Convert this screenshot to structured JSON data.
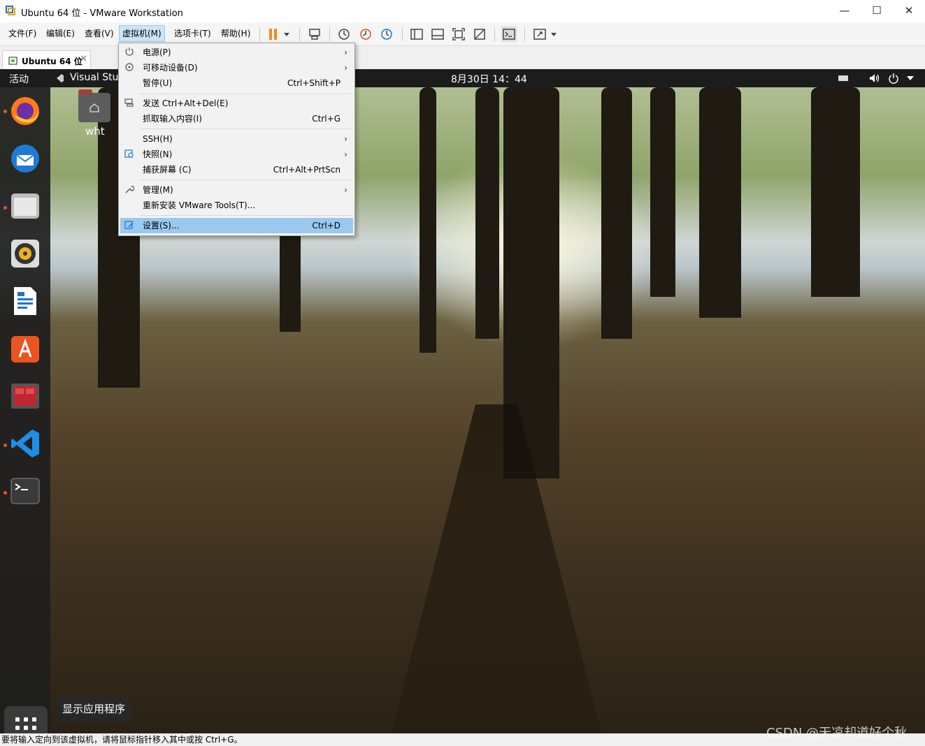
{
  "window": {
    "title": "Ubuntu 64 位 - VMware Workstation",
    "minimize": "—",
    "maximize": "☐",
    "close": "✕"
  },
  "menubar": {
    "items": [
      "文件(F)",
      "编辑(E)",
      "查看(V)",
      "虚拟机(M)",
      "选项卡(T)",
      "帮助(H)"
    ],
    "active_index": 3
  },
  "tab": {
    "label": "Ubuntu 64 位",
    "close": "✕"
  },
  "vm_topbar": {
    "activities": "活动",
    "app": "Visual Stud",
    "clock": "8月30日  14：44"
  },
  "desktop": {
    "home_label": "wht",
    "tooltip": "显示应用程序"
  },
  "dock": {
    "icons": [
      "firefox-icon",
      "thunderbird-icon",
      "files-icon",
      "rhythmbox-icon",
      "writer-icon",
      "software-icon",
      "remmina-icon",
      "vscode-icon",
      "terminal-icon"
    ]
  },
  "dropdown": {
    "items": [
      {
        "label": "电源(P)",
        "shortcut": "",
        "submenu": true
      },
      {
        "label": "可移动设备(D)",
        "shortcut": "",
        "submenu": true
      },
      {
        "label": "暂停(U)",
        "shortcut": "Ctrl+Shift+P",
        "submenu": false
      },
      {
        "label": "发送 Ctrl+Alt+Del(E)",
        "shortcut": "",
        "submenu": false
      },
      {
        "label": "抓取输入内容(I)",
        "shortcut": "Ctrl+G",
        "submenu": false
      },
      {
        "label": "SSH(H)",
        "shortcut": "",
        "submenu": true
      },
      {
        "label": "快照(N)",
        "shortcut": "",
        "submenu": true
      },
      {
        "label": "捕获屏幕 (C)",
        "shortcut": "Ctrl+Alt+PrtScn",
        "submenu": false
      },
      {
        "label": "管理(M)",
        "shortcut": "",
        "submenu": true
      },
      {
        "label": "重新安装 VMware Tools(T)...",
        "shortcut": "",
        "submenu": false
      },
      {
        "label": "设置(S)...",
        "shortcut": "Ctrl+D",
        "submenu": false
      }
    ],
    "highlighted": "设置(S)..."
  },
  "statusbar": {
    "message": "要将输入定向到该虚拟机，请将鼠标指针移入其中或按 Ctrl+G。"
  },
  "watermark": "CSDN @天凉却道好个秋",
  "colors": {
    "menu_highlight": "#99c9ef",
    "dock_dot": "#e95420",
    "topbar": "#1c1c1c"
  }
}
